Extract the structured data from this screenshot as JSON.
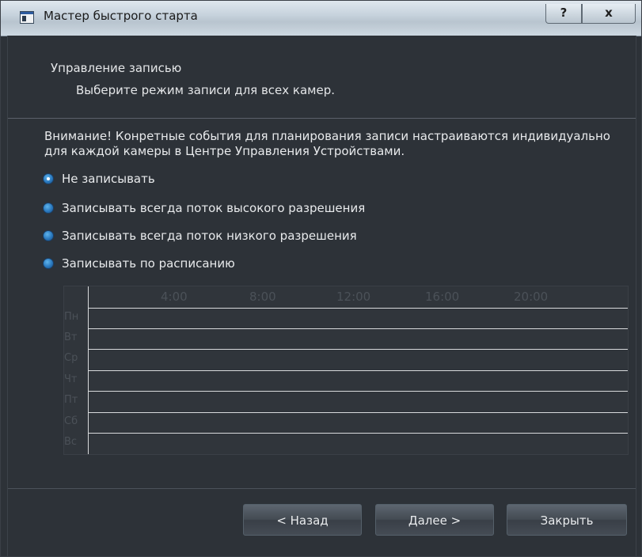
{
  "window": {
    "title": "Мастер быстрого старта",
    "help_label": "?",
    "close_label": "x"
  },
  "header": {
    "title": "Управление записью",
    "subtitle": "Выберите режим записи для всех камер."
  },
  "notice": "Внимание! Конретные события для планирования записи настраиваются индивидуально для каждой камеры в Центре Управления Устройствами.",
  "recording_modes": [
    {
      "label": "Не записывать",
      "checked": true
    },
    {
      "label": "Записывать всегда поток высокого разрешения",
      "checked": false
    },
    {
      "label": "Записывать всегда поток низкого разрешения",
      "checked": false
    },
    {
      "label": "Записывать по расписанию",
      "checked": false
    }
  ],
  "schedule": {
    "hours": [
      "4:00",
      "8:00",
      "12:00",
      "16:00",
      "20:00"
    ],
    "days": [
      "Пн",
      "Вт",
      "Ср",
      "Чт",
      "Пт",
      "Сб",
      "Вс"
    ],
    "enabled": false
  },
  "buttons": {
    "back": "< Назад",
    "next": "Далее >",
    "close": "Закрыть"
  },
  "colors": {
    "background": "#2d3238",
    "radio_accent": "#2a79be"
  }
}
